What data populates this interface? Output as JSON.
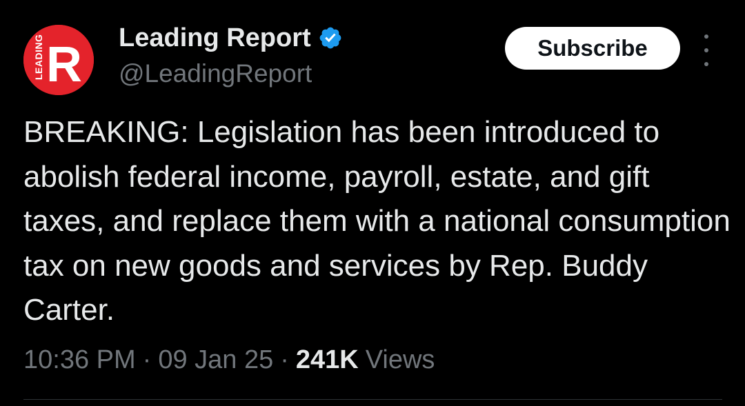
{
  "account": {
    "display_name": "Leading Report",
    "handle": "@LeadingReport",
    "verified": true,
    "avatar_letter": "R",
    "avatar_side_text": "LEADING",
    "avatar_color": "#e4232b"
  },
  "actions": {
    "subscribe_label": "Subscribe",
    "more_icon": "more-vertical-icon"
  },
  "tweet": {
    "text": "BREAKING: Legislation has been introduced to abolish federal income, payroll, estate, and gift taxes, and replace them with a national consumption tax on new goods and services by Rep. Buddy Carter."
  },
  "meta": {
    "time": "10:36 PM",
    "date": "09 Jan 25",
    "separator": "·",
    "views_count": "241K",
    "views_label": "Views"
  },
  "colors": {
    "background": "#000000",
    "primary_text": "#e7e9ea",
    "secondary_text": "#71767b",
    "verified_blue": "#1d9bf0",
    "subscribe_bg": "#ffffff"
  }
}
